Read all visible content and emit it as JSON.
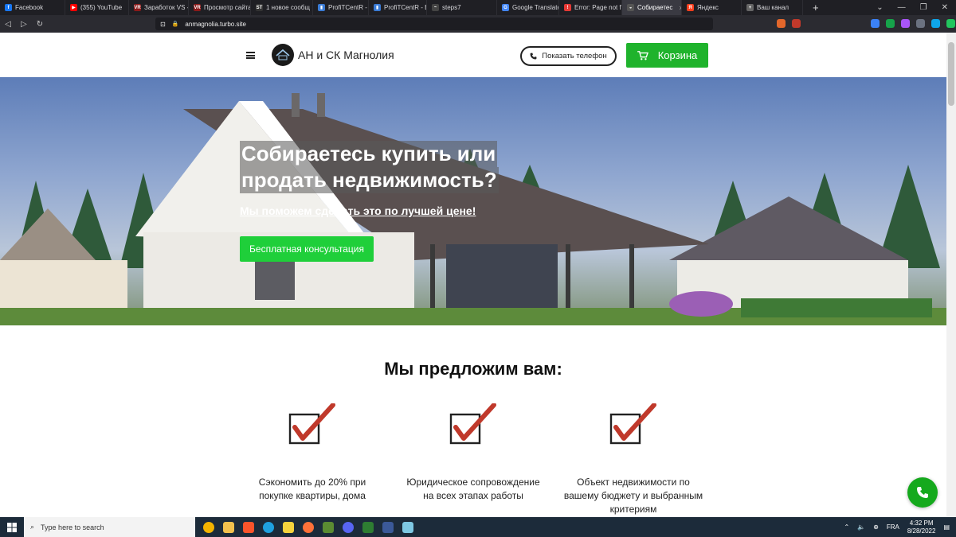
{
  "browser": {
    "tabs": [
      {
        "label": "Facebook",
        "color": "#1877f2",
        "glyph": "f"
      },
      {
        "label": "(355) YouTube",
        "color": "#ff0000",
        "glyph": "▶"
      },
      {
        "label": "Заработок VS -",
        "color": "#8b1a1a",
        "glyph": "VR"
      },
      {
        "label": "Просмотр сайта",
        "color": "#8b1a1a",
        "glyph": "VR"
      },
      {
        "label": "1 новое сообщ",
        "color": "#333333",
        "glyph": "ST"
      },
      {
        "label": "ProfiTCentR - Ва",
        "color": "#3a7bd5",
        "glyph": "▮"
      },
      {
        "label": "ProfiTCentR - Exi",
        "color": "#3a7bd5",
        "glyph": "▮"
      },
      {
        "label": "steps7",
        "color": "#444444",
        "glyph": "~"
      },
      {
        "label": "Google Translate",
        "color": "#4285f4",
        "glyph": "G"
      },
      {
        "label": "Error: Page not f",
        "color": "#e53935",
        "glyph": "!"
      },
      {
        "label": "Собираетес",
        "color": "#555555",
        "glyph": "◒",
        "active": true
      },
      {
        "label": "Яндекс",
        "color": "#fc3f1d",
        "glyph": "Я"
      },
      {
        "label": "Ваш канал",
        "color": "#666666",
        "glyph": "+"
      }
    ],
    "new_tab": "+",
    "url": "anmagnolia.turbo.site"
  },
  "header": {
    "brand": "АН и СК Магнолия",
    "phone_label": "Показать телефон",
    "cart_label": "Корзина"
  },
  "hero": {
    "title_line1": "Собираетесь купить или",
    "title_line2": "продать недвижимость?",
    "subtitle": "Мы поможем сделать это по лучшей цене!",
    "cta": "Бесплатная консультация"
  },
  "offers": {
    "title": "Мы предложим вам:",
    "items": [
      {
        "text": "Сэкономить до 20% при покупке квартиры, дома"
      },
      {
        "text": "Юридическое сопровождение на всех этапах работы"
      },
      {
        "text": "Объект недвижимости по вашему бюджету и выбранным критериям"
      }
    ]
  },
  "taskbar": {
    "search_placeholder": "Type here to search",
    "lang": "FRA",
    "time": "4:32 PM",
    "date": "8/28/2022"
  },
  "colors": {
    "accent_green": "#1fb32c",
    "cta_green": "#1fcf3a",
    "check_red": "#c0392b"
  }
}
